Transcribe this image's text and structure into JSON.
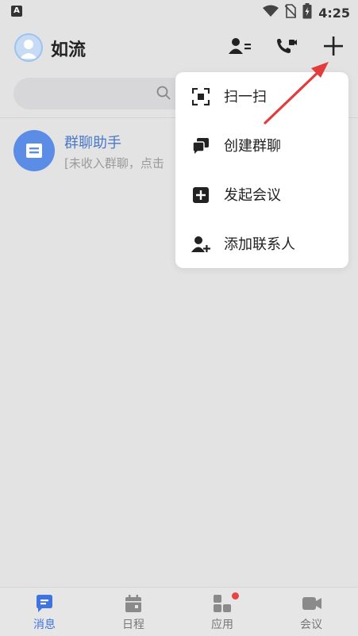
{
  "status_bar": {
    "left_badge": "A",
    "time": "4:25",
    "icons": [
      "wifi-icon",
      "no-sim-icon",
      "battery-charging-icon"
    ]
  },
  "header": {
    "title": "如流",
    "actions": [
      "contacts-icon",
      "phone-call-icon",
      "plus-icon"
    ]
  },
  "search": {
    "placeholder": ""
  },
  "conversations": [
    {
      "title": "群聊助手",
      "preview": "[未收入群聊，点击"
    }
  ],
  "popup_menu": [
    {
      "label": "扫一扫",
      "icon": "scan-icon"
    },
    {
      "label": "创建群聊",
      "icon": "group-chat-icon"
    },
    {
      "label": "发起会议",
      "icon": "start-meeting-icon"
    },
    {
      "label": "添加联系人",
      "icon": "add-contact-icon"
    }
  ],
  "tabbar": [
    {
      "label": "消息",
      "icon": "message-icon",
      "active": true
    },
    {
      "label": "日程",
      "icon": "calendar-icon",
      "active": false
    },
    {
      "label": "应用",
      "icon": "apps-icon",
      "active": false,
      "badge": true
    },
    {
      "label": "会议",
      "icon": "video-icon",
      "active": false
    }
  ],
  "colors": {
    "accent": "#3f74e0",
    "annotation_arrow": "#e23c3c",
    "badge": "#e94343",
    "background": "#e3e3e4"
  }
}
